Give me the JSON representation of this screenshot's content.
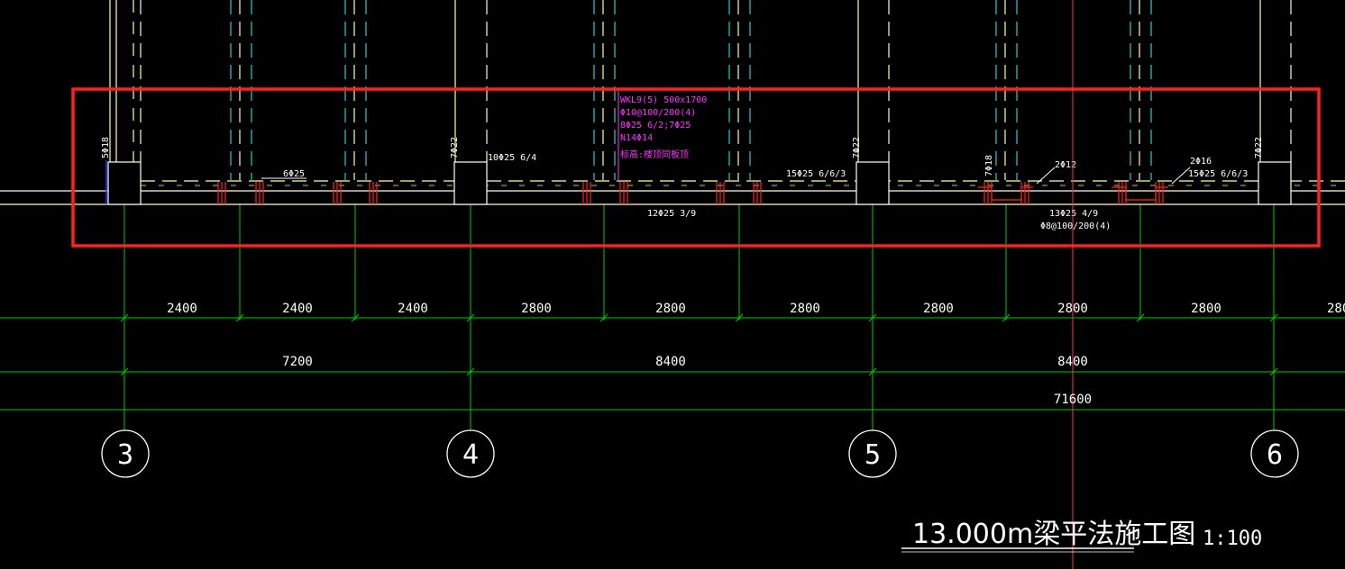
{
  "colors": {
    "background": "#000000",
    "grid_line": "#00cc00",
    "beam_line": "#ffffcc",
    "dashed_cyan": "#33cccc",
    "dashed_yellow": "#ffffaa",
    "stirrup_red": "#ff2222",
    "highlight_red": "#ff2020",
    "annotation_magenta": "#ff33ff",
    "text_white": "#ffffff"
  },
  "drawing": {
    "title": "13.000m梁平法施工图",
    "scale": "1:100"
  },
  "axes": [
    "3",
    "4",
    "5",
    "6"
  ],
  "dimensions": {
    "row1": [
      "2400",
      "2400",
      "2400",
      "2800",
      "2800",
      "2800",
      "2800",
      "2800",
      "2800",
      "280"
    ],
    "row2": [
      "7200",
      "8400",
      "8400"
    ],
    "total": "71600"
  },
  "beam_label": {
    "line1": "WKL9(5) 500x1700",
    "line2": "Φ10@100/200(4)",
    "line3": "8Φ25 6/2;7Φ25",
    "line4": "N14Φ14",
    "line5": "标高:楼顶同板顶"
  },
  "rebar_notes": {
    "col3_top": "5Φ18",
    "span1_top": "6Φ25",
    "col4_top": "7Φ22",
    "col4_right": "10Φ25 6/4",
    "mid_bottom": "12Φ25 3/9",
    "span_right_top": "15Φ25 6/6/3",
    "col5_top": "7Φ22",
    "col_sec_top": "7Φ18",
    "sec_top": "2Φ12",
    "sec_bottom": "13Φ25 4/9",
    "sec_stirrup": "Φ8@100/200(4)",
    "right_a": "2Φ16",
    "right_b": "15Φ25 6/6/3",
    "col6_top": "7Φ22"
  }
}
